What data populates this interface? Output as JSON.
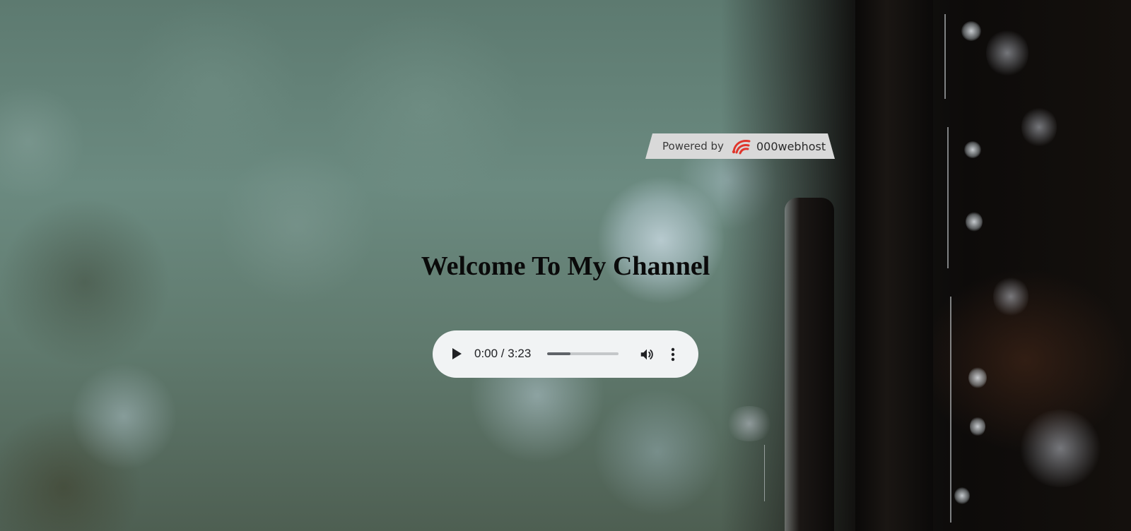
{
  "page": {
    "heading": "Welcome To My Channel"
  },
  "badge": {
    "prefix": "Powered by",
    "brand": "000webhost",
    "logo_icon": "000webhost-logo-icon"
  },
  "audio": {
    "current_time": "0:00",
    "separator": " / ",
    "duration": "3:23",
    "time_text": "0:00 / 3:23",
    "buffered_fraction": 0.33,
    "play_icon": "play-icon",
    "volume_icon": "volume-icon",
    "menu_icon": "more-vert-icon"
  },
  "colors": {
    "player_bg": "#f1f3f4",
    "badge_bg": "#d9d9d9",
    "logo_red": "#e0362c",
    "heading": "#0a0a0a"
  }
}
